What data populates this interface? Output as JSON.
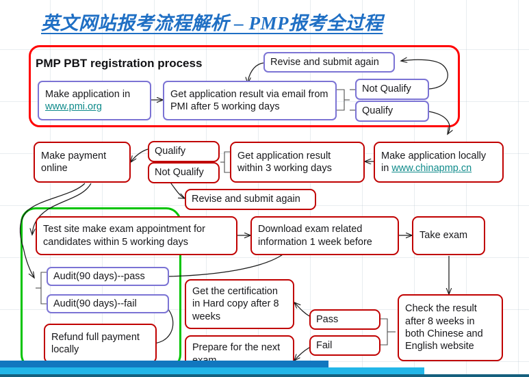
{
  "slide": {
    "title": "英文网站报考流程解析 – PMP报考全过程",
    "section_heading": "PMP PBT registration process"
  },
  "nodes": {
    "make_application_pmi_line1": "Make application in",
    "make_application_pmi_link": "www.pmi.org",
    "get_result_email": "Get application result via email from PMI after 5 working days",
    "revise_submit_top": "Revise and submit again",
    "not_qualify_top": "Not Qualify",
    "qualify_top": "Qualify",
    "make_payment_online": "Make payment online",
    "qualify_mid": "Qualify",
    "not_qualify_mid": "Not Qualify",
    "get_result_3days": "Get application result within 3 working days",
    "make_application_local_line1": "Make application locally",
    "make_application_local_prefix": "in ",
    "make_application_local_link": "www.chinapmp.cn",
    "revise_submit_mid": "Revise and submit again",
    "test_site_appointment": "Test site make exam appointment for candidates within 5 working days",
    "download_exam_info": "Download exam related information 1 week before",
    "take_exam": "Take exam",
    "audit_pass": "Audit(90 days)--pass",
    "audit_fail": "Audit(90 days)--fail",
    "refund_payment": "Refund full payment locally",
    "get_certification": "Get the certification in Hard copy after 8 weeks",
    "prepare_next_exam": "Prepare for the next exam",
    "pass": "Pass",
    "fail": "Fail",
    "check_result": "Check the result after 8 weeks in both Chinese and English website"
  },
  "colors": {
    "title_blue": "#1F6FC4",
    "red_border": "#C00000",
    "bright_red_frame": "#FF0000",
    "purple_border": "#7B73D4",
    "green_frame": "#00C400",
    "link_teal": "#0E8A8A",
    "bar_dark_blue": "#1177BF",
    "bar_light_blue": "#22B6E8",
    "bar_rule": "#15607E"
  }
}
